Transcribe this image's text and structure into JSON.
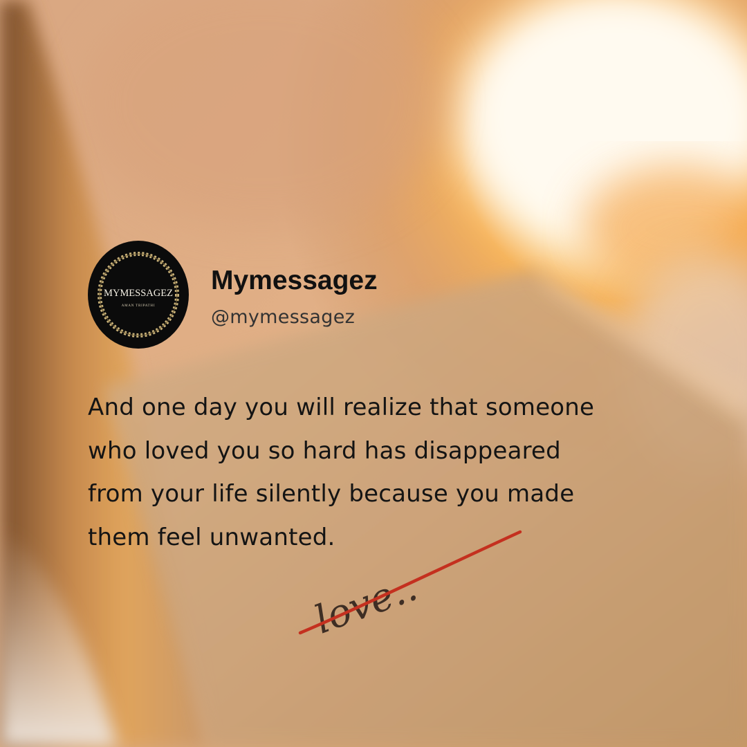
{
  "profile": {
    "name": "Mymessagez",
    "handle": "@mymessagez",
    "avatar_title": "MYMESSAGEZ",
    "avatar_subtitle": "AMAN TRIPATHI"
  },
  "post": {
    "lines": [
      "And one day you will realize that someone",
      "who loved you so hard has disappeared",
      "from your life silently because you made",
      "them feel unwanted."
    ]
  },
  "photo": {
    "handwriting": "love.."
  },
  "colors": {
    "text": "#141414",
    "avatar_bg": "#0b0b0b",
    "avatar_gold": "#c9b27a",
    "underline_red": "#c4301f",
    "sun_glow": "#fff6d8"
  }
}
